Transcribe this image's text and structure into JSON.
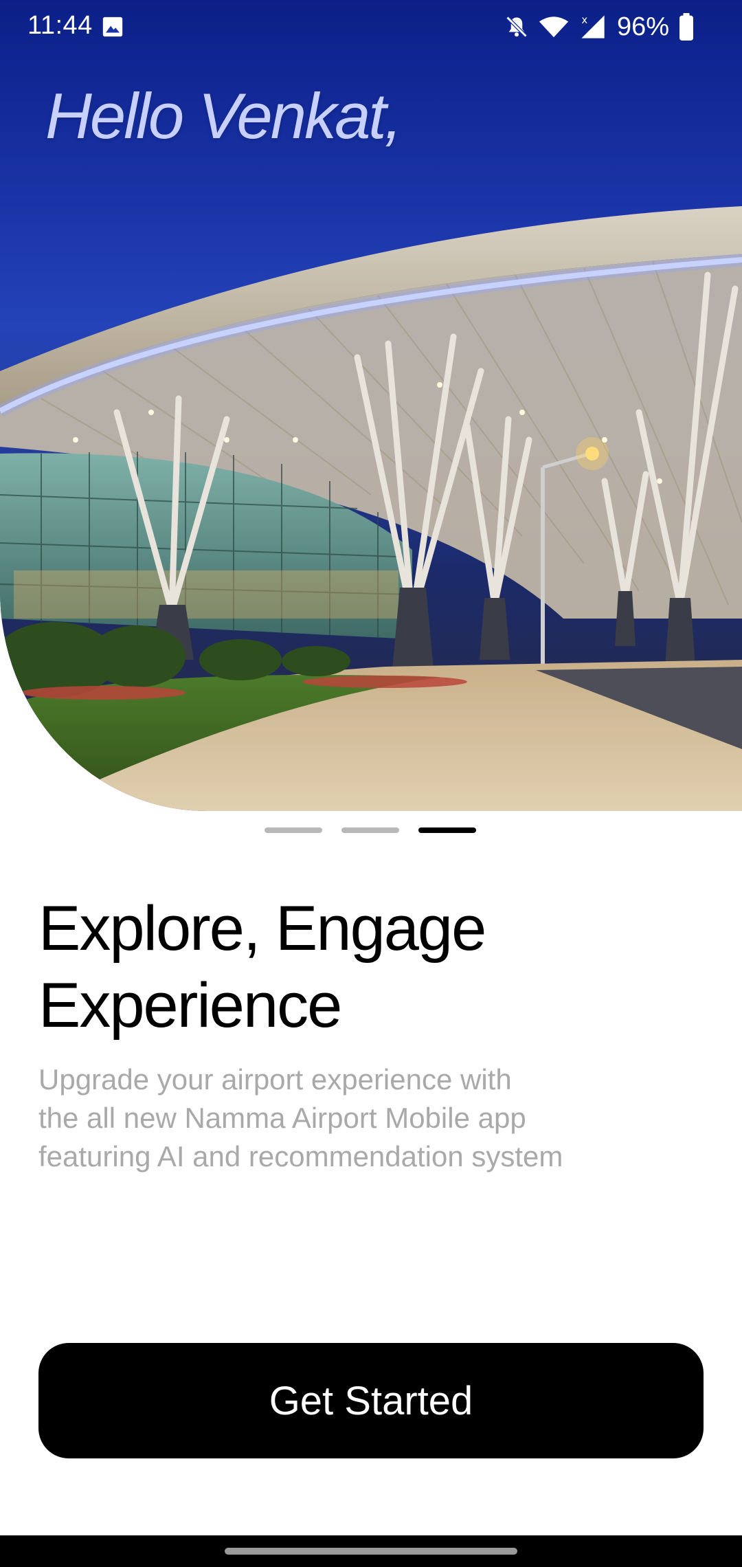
{
  "status_bar": {
    "time": "11:44",
    "battery_percent": "96%",
    "icons": [
      "image-icon",
      "bell-off-icon",
      "wifi-icon",
      "signal-icon",
      "battery-icon"
    ]
  },
  "hero": {
    "greeting": "Hello Venkat,",
    "image_subject": "airport-terminal-photo"
  },
  "pager": {
    "pages": 3,
    "active_index": 2
  },
  "content": {
    "headline_lines": [
      "Explore, Engage",
      "Experience"
    ],
    "subtitle_lines": [
      "Upgrade your airport experience with",
      "the all new Namma Airport Mobile app",
      "featuring AI and recommendation system"
    ]
  },
  "cta": {
    "label": "Get Started"
  },
  "colors": {
    "sky": "#1a34a8",
    "greeting": "#c7d0ff",
    "headline": "#000000",
    "subtitle": "#a9a9a9",
    "button_bg": "#000000",
    "button_text": "#ffffff",
    "pager_active": "#000000",
    "pager_inactive": "#b9b9b9"
  }
}
